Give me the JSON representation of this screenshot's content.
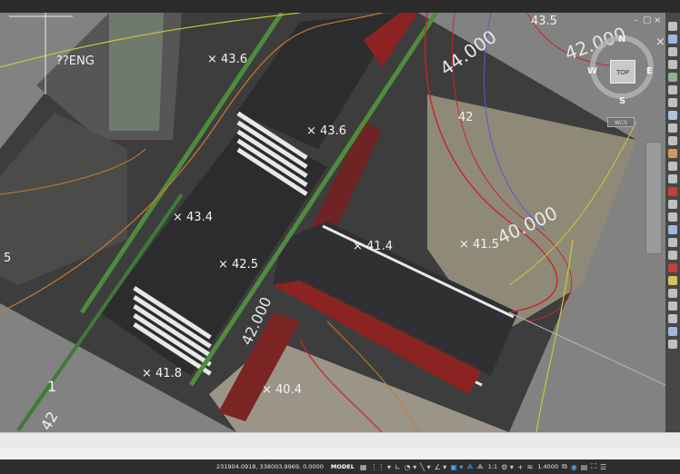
{
  "window": {
    "restore_glyph": "▢",
    "close_glyph": "×",
    "minimize_glyph": "–"
  },
  "viewport": {
    "label": "??ENG",
    "elevations": [
      "× 43.6",
      "× 43.6",
      "× 43.4",
      "× 42.5",
      "× 41.8",
      "× 40.4",
      "× 41.5",
      "× 41.4"
    ],
    "contours": [
      "42.000",
      "44.000",
      "40.000",
      "42.000",
      "43.5",
      "42"
    ],
    "edge_labels": [
      "5",
      "1",
      "42"
    ]
  },
  "navcube": {
    "north": "N",
    "south": "S",
    "east": "E",
    "west": "W",
    "top": "TOP",
    "wcs": "WCS"
  },
  "statusbar": {
    "coordinates": "231904.0918, 338003.9969, 0.0000",
    "model": "MODEL",
    "scale": "1:1",
    "lineweight": "1.4000"
  },
  "colors": {
    "viewport_bg": "#828282",
    "asphalt": "#2c2c2e",
    "red_lane": "#8b2323",
    "green_strip": "#4e8d3e",
    "contour_orange": "#c97a2a",
    "contour_red": "#c8242c",
    "contour_yellow": "#c8c832",
    "status_bg": "#2e2e2e"
  },
  "icons": [
    "restore-icon",
    "close-icon",
    "compass-ring-icon",
    "grid-icon",
    "snap-icon",
    "ortho-icon",
    "polar-icon",
    "osnap-icon",
    "annotation-icon",
    "workspace-icon",
    "lineweight-icon",
    "fullscreen-icon"
  ]
}
